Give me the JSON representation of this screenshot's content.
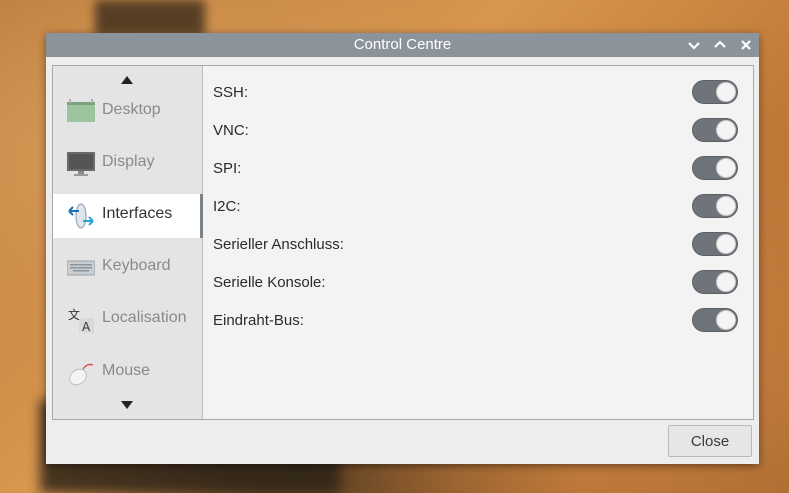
{
  "window": {
    "title": "Control Centre",
    "controls": {
      "minimize_icon": "chevron-down-icon",
      "maximize_icon": "chevron-up-icon",
      "close_icon": "close-icon"
    }
  },
  "sidebar": {
    "scroll_up_icon": "triangle-up-icon",
    "scroll_down_icon": "triangle-down-icon",
    "items": [
      {
        "label": "Desktop",
        "icon": "desktop-icon",
        "active": false
      },
      {
        "label": "Display",
        "icon": "monitor-icon",
        "active": false
      },
      {
        "label": "Interfaces",
        "icon": "interfaces-icon",
        "active": true
      },
      {
        "label": "Keyboard",
        "icon": "keyboard-icon",
        "active": false
      },
      {
        "label": "Localisation",
        "icon": "localisation-icon",
        "active": false
      },
      {
        "label": "Mouse",
        "icon": "mouse-icon",
        "active": false
      }
    ]
  },
  "interfaces": {
    "rows": [
      {
        "label": "SSH:",
        "enabled": false
      },
      {
        "label": "VNC:",
        "enabled": false
      },
      {
        "label": "SPI:",
        "enabled": false
      },
      {
        "label": "I2C:",
        "enabled": false
      },
      {
        "label": "Serieller Anschluss:",
        "enabled": false
      },
      {
        "label": "Serielle Konsole:",
        "enabled": false
      },
      {
        "label": "Eindraht-Bus:",
        "enabled": false
      }
    ]
  },
  "footer": {
    "close_label": "Close"
  },
  "colors": {
    "titlebar": "#8c949b",
    "toggle_off": "#6e747a",
    "active_item": "#ffffff"
  }
}
